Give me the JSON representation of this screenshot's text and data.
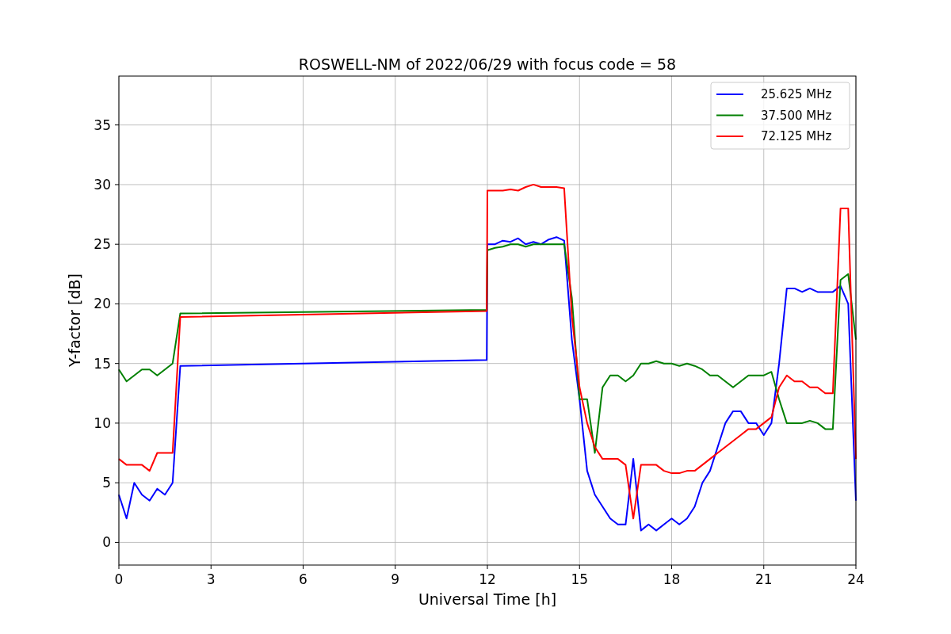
{
  "chart_data": {
    "type": "line",
    "title": "ROSWELL-NM of 2022/06/29 with focus code = 58",
    "xlabel": "Universal Time [h]",
    "ylabel": "Y-factor [dB]",
    "x": [
      0,
      0.25,
      0.5,
      0.75,
      1,
      1.25,
      1.5,
      1.75,
      2,
      11.98,
      12,
      12.25,
      12.5,
      12.75,
      13,
      13.25,
      13.5,
      13.75,
      14,
      14.25,
      14.5,
      14.75,
      15,
      15.25,
      15.5,
      15.75,
      16,
      16.25,
      16.5,
      16.75,
      17,
      17.25,
      17.5,
      17.75,
      18,
      18.25,
      18.5,
      18.75,
      19,
      19.25,
      19.5,
      19.75,
      20,
      20.25,
      20.5,
      20.75,
      21,
      21.25,
      21.5,
      21.75,
      22,
      22.25,
      22.5,
      22.75,
      23,
      23.25,
      23.5,
      23.75,
      24
    ],
    "series": [
      {
        "name": "25.625 MHz",
        "color": "#0000ff",
        "values": [
          4,
          2,
          5,
          4,
          3.5,
          4.5,
          4,
          5,
          14.8,
          15.3,
          25,
          25,
          25.3,
          25.2,
          25.5,
          25,
          25.2,
          25,
          25.4,
          25.6,
          25.3,
          17,
          12,
          6,
          4,
          3,
          2,
          1.5,
          1.5,
          7,
          1,
          1.5,
          1,
          1.5,
          2,
          1.5,
          2,
          3,
          5,
          6,
          8,
          10,
          11,
          11,
          10,
          10,
          9,
          10,
          15,
          21.3,
          21.3,
          21,
          21.3,
          21,
          21,
          21,
          21.5,
          20,
          3.5
        ]
      },
      {
        "name": "37.500 MHz",
        "color": "#008000",
        "values": [
          14.5,
          13.5,
          14,
          14.5,
          14.5,
          14,
          14.5,
          15,
          19.2,
          19.5,
          24.5,
          24.7,
          24.8,
          25,
          25,
          24.8,
          25,
          25,
          25,
          25,
          25,
          20.5,
          12,
          12,
          7.5,
          13,
          14,
          14,
          13.5,
          14,
          15,
          15,
          15.2,
          15,
          15,
          14.8,
          15,
          14.8,
          14.5,
          14,
          14,
          13.5,
          13,
          13.5,
          14,
          14,
          14,
          14.3,
          12,
          10,
          10,
          10,
          10.2,
          10,
          9.5,
          9.5,
          22,
          22.5,
          17
        ]
      },
      {
        "name": "72.125 MHz",
        "color": "#ff0000",
        "values": [
          7,
          6.5,
          6.5,
          6.5,
          6,
          7.5,
          7.5,
          7.5,
          18.9,
          19.4,
          29.5,
          29.5,
          29.5,
          29.6,
          29.5,
          29.8,
          30,
          29.8,
          29.8,
          29.8,
          29.7,
          19,
          13,
          10,
          8,
          7,
          7,
          7,
          6.5,
          2,
          6.5,
          6.5,
          6.5,
          6,
          5.8,
          5.8,
          6,
          6,
          6.5,
          7,
          7.5,
          8,
          8.5,
          9,
          9.5,
          9.5,
          10,
          10.5,
          13,
          14,
          13.5,
          13.5,
          13,
          13,
          12.5,
          12.5,
          28,
          28,
          7
        ]
      }
    ],
    "grid": true,
    "legend": true,
    "xlim": [
      0,
      24
    ],
    "ylim": [
      -1.9,
      39.1
    ],
    "xticks": [
      0,
      3,
      6,
      9,
      12,
      15,
      18,
      21,
      24
    ],
    "yticks": [
      0,
      5,
      10,
      15,
      20,
      25,
      30,
      35
    ]
  }
}
